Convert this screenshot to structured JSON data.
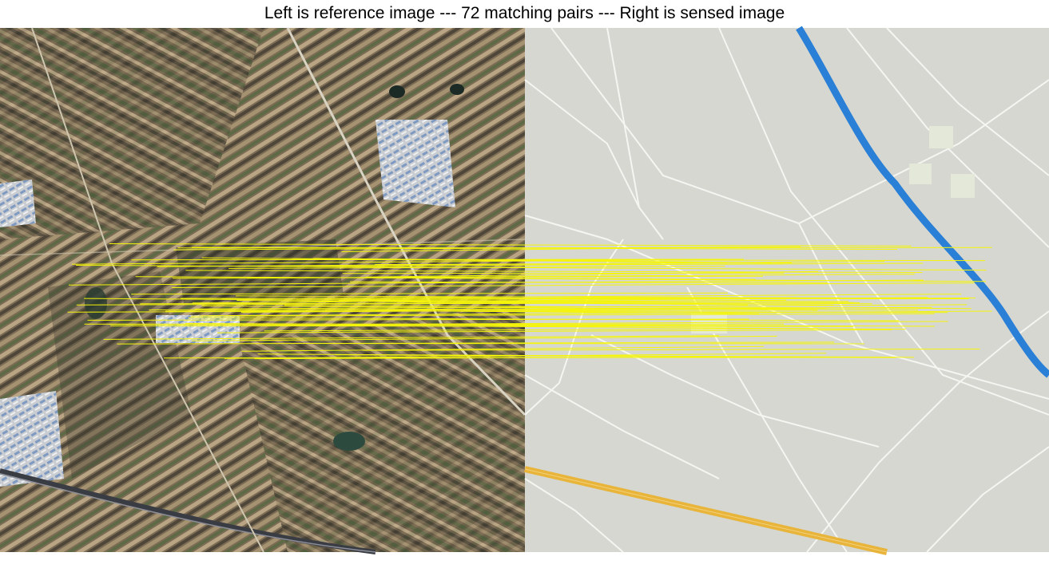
{
  "figure": {
    "title": "Left is reference image --- 72 matching pairs --- Right is sensed image",
    "match_count": 72,
    "panels": {
      "left": {
        "role": "reference image",
        "kind": "satellite imagery"
      },
      "right": {
        "role": "sensed image",
        "kind": "street map"
      }
    },
    "colors": {
      "match_line": "#f5f50a",
      "map_background": "#d5d7d0",
      "map_road": "#f5f5f2",
      "map_river": "#2a7fd6",
      "map_highway": "#e8b43a",
      "map_built_area": "#e3e8d8"
    }
  }
}
